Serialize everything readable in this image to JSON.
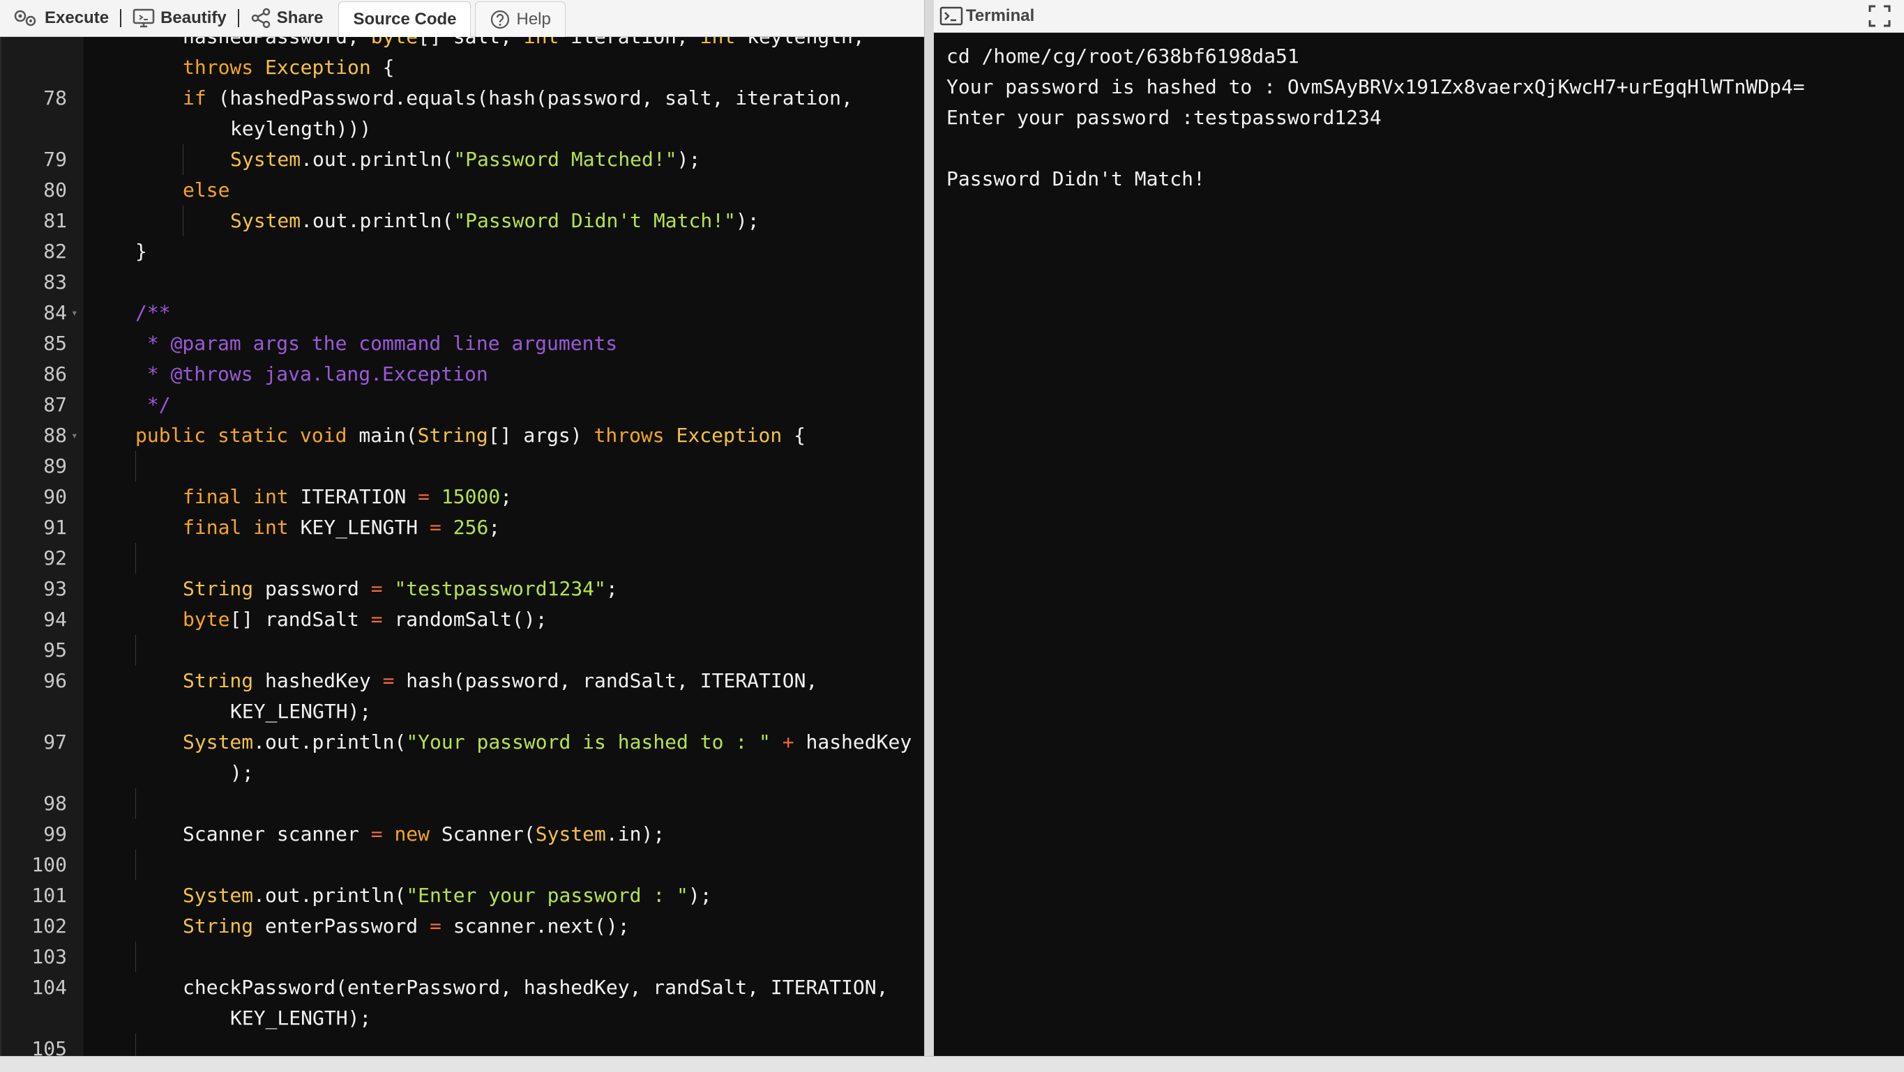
{
  "toolbar": {
    "execute": "Execute",
    "beautify": "Beautify",
    "share": "Share",
    "source_code": "Source Code",
    "help": "Help"
  },
  "terminal": {
    "title": "Terminal",
    "lines": [
      "cd /home/cg/root/638bf6198da51",
      "Your password is hashed to : OvmSAyBRVx191Zx8vaerxQjKwcH7+urEgqHlWTnWDp4=",
      "Enter your password :testpassword1234",
      "",
      "Password Didn't Match!"
    ]
  },
  "editor": {
    "partial_top": {
      "a": "hashedPassword, ",
      "b": "byte",
      "c": "[] salt, ",
      "d": "int",
      "e": " iteration, ",
      "f": "int",
      "g": " keylength,"
    },
    "line_numbers": [
      "78",
      "79",
      "80",
      "81",
      "82",
      "83",
      "84",
      "85",
      "86",
      "87",
      "88",
      "89",
      "90",
      "91",
      "92",
      "93",
      "94",
      "95",
      "96",
      "97",
      "98",
      "99",
      "100",
      "101",
      "102",
      "103",
      "104",
      "105"
    ],
    "tokens": {
      "throws": "throws",
      "exception": "Exception",
      "brace_open": " {",
      "if": "if",
      "l78a": " (hashedPassword.equals(hash(password, salt, iteration,",
      "l78b": "keylength)))",
      "system": "System",
      "println": ".out.println(",
      "matched": "\"Password Matched!\"",
      "end": ");",
      "else": "else",
      "didnt": "\"Password Didn't Match!\"",
      "close": "}",
      "c84": "/**",
      "c85": " * @param args the command line arguments",
      "c86": " * @throws java.lang.Exception",
      "c87": " */",
      "public": "public",
      "static": "static",
      "void": "void",
      "main": " main(",
      "String": "String",
      "args": "[] args) ",
      "final": "final",
      "int": "int",
      "iteration": " ITERATION ",
      "eq": "=",
      "n15000": "15000",
      "semi": ";",
      "keylen": " KEY_LENGTH ",
      "n256": "256",
      "password": " password ",
      "pwstr": "\"testpassword1234\"",
      "byte": "byte",
      "randsalt": "[] randSalt ",
      "randcall": " randomSalt();",
      "hashedkey": " hashedKey ",
      "hashcall": " hash(password, randSalt, ITERATION,",
      "keylength_end": "KEY_LENGTH);",
      "yourpw": "\"Your password is hashed to : \"",
      "plus": "+",
      "hashedKeyVar": " hashedKey",
      "close_paren": ");",
      "scanner_decl": "Scanner scanner ",
      "new": "new",
      "scanner_new": " Scanner(",
      "sysin": ".in);",
      "enterpw": "\"Enter your password : \"",
      "enterPassword": " enterPassword ",
      "scannernext": " scanner.next();",
      "check_a": "checkPassword(enterPassword, hashedKey, randSalt, ITERATION,",
      "check_b": "KEY_LENGTH);"
    }
  }
}
